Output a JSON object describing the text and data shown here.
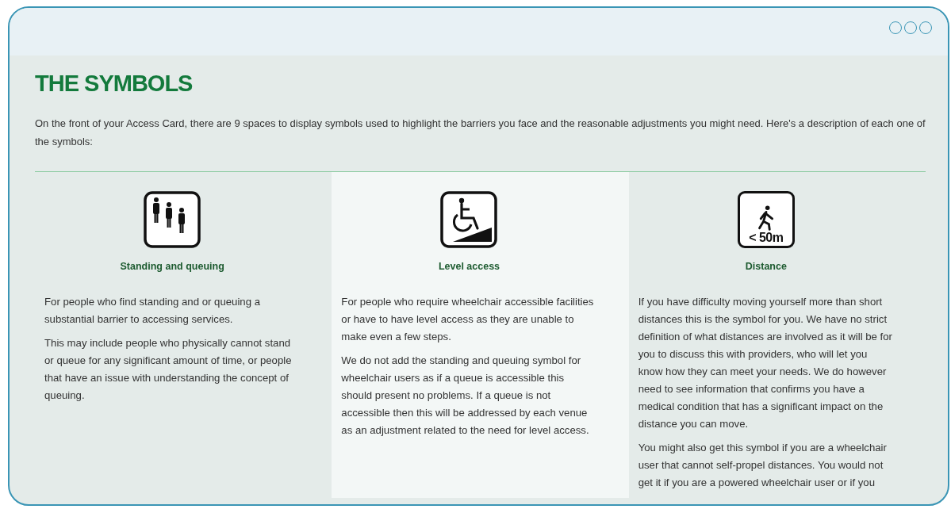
{
  "heading": "THE SYMBOLS",
  "intro": "On the front of your Access Card, there are 9 spaces to display symbols used to highlight the barriers you face and the reasonable adjustments you might need. Here's a description of each one of the symbols:",
  "symbols": [
    {
      "kind": "queue",
      "title": "Standing and queuing",
      "highlighted": false,
      "paragraphs": [
        "For people who find standing and or queuing a substantial barrier to accessing services.",
        "This may include people who physically cannot stand or queue for any significant amount of time, or people that have an issue with understanding the concept of queuing."
      ]
    },
    {
      "kind": "wheelchair",
      "title": "Level access",
      "highlighted": true,
      "paragraphs": [
        "For people who require wheelchair accessible facilities or have to have level access as they are unable to make even a few steps.",
        "We do not add the standing and queuing symbol for wheelchair users as if a queue is accessible this should present no problems. If a queue is not accessible then this will be addressed by each venue as an adjustment related to the need for level access."
      ]
    },
    {
      "kind": "distance",
      "icon_text": "< 50m",
      "title": "Distance",
      "highlighted": false,
      "paragraphs": [
        "If you have difficulty moving yourself more than short distances this is the symbol for you. We have no strict definition of what distances are involved as it will be for you to discuss this with providers, who will let you know how they can meet your needs. We do however need to see information that confirms you have a medical condition that has a significant impact on the distance you can move.",
        "You might also get this symbol if you are a wheelchair user that cannot self-propel distances. You would not get it if you are a powered wheelchair user or if you"
      ]
    }
  ]
}
